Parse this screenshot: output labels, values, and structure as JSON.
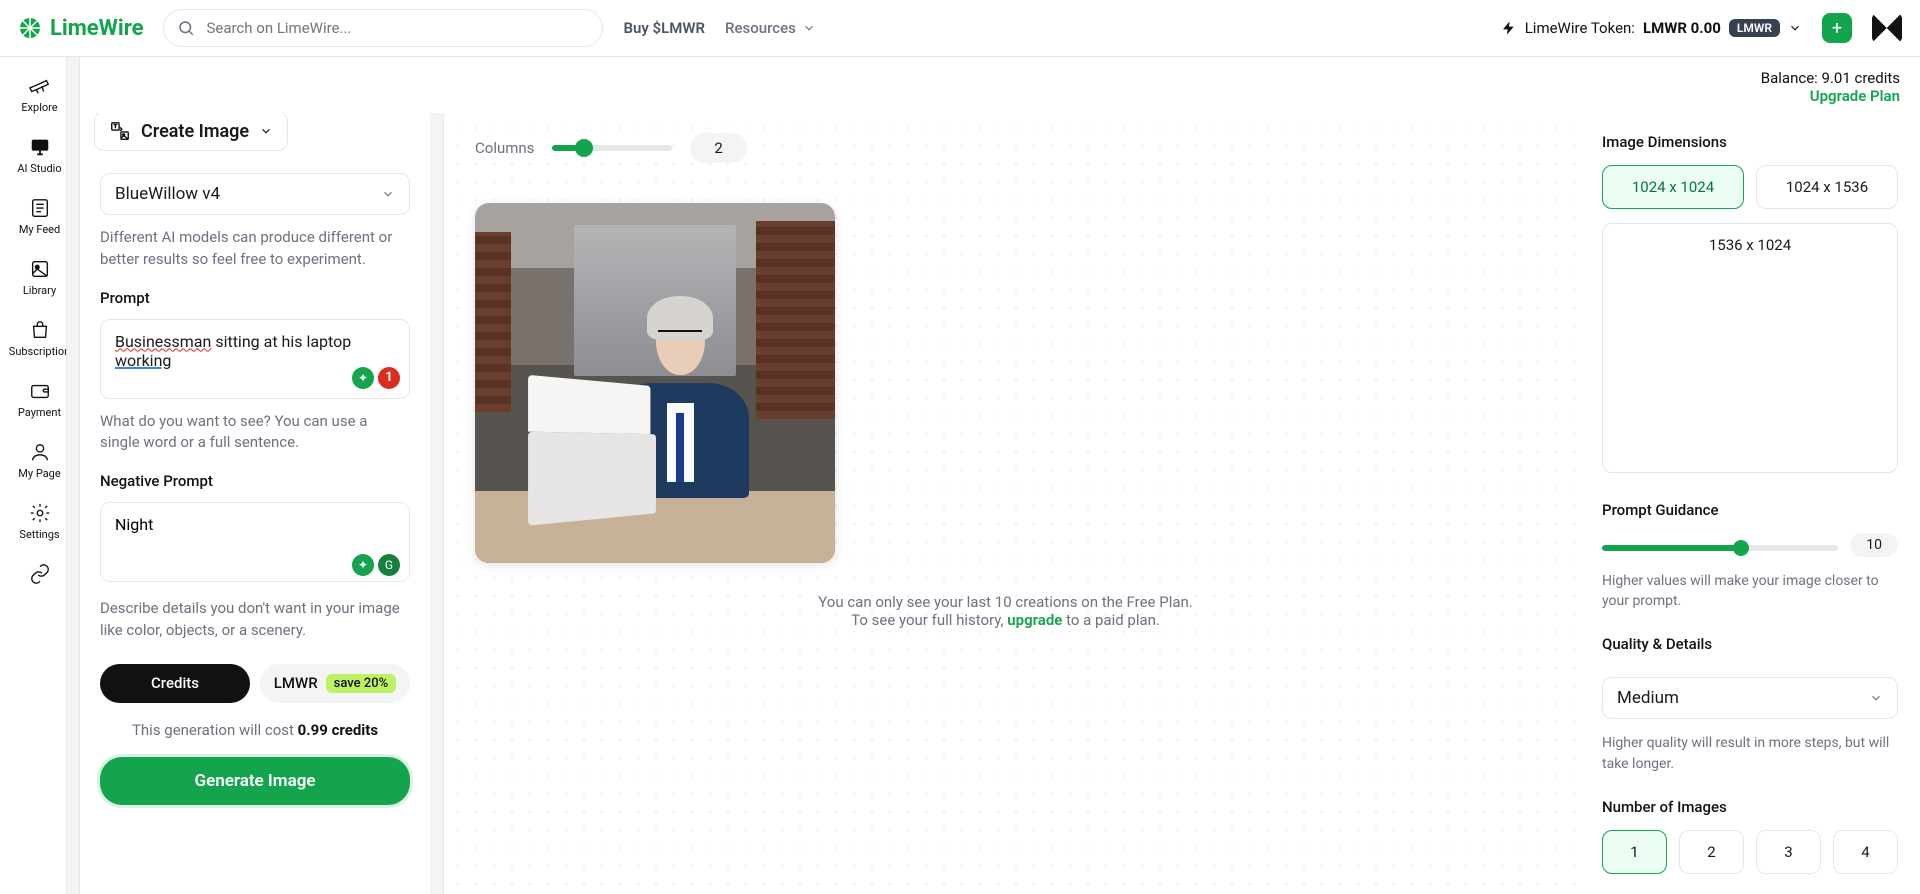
{
  "brand": "LimeWire",
  "search_placeholder": "Search on LimeWire...",
  "header": {
    "buy": "Buy $LMWR",
    "resources": "Resources",
    "token_label": "LimeWire Token:",
    "token_value": "LMWR 0.00",
    "token_badge": "LMWR"
  },
  "nav": {
    "explore": "Explore",
    "ai_studio": "AI Studio",
    "my_feed": "My Feed",
    "library": "Library",
    "subscription": "Subscription",
    "payment": "Payment",
    "my_page": "My Page",
    "settings": "Settings"
  },
  "balance": {
    "text": "Balance: 9.01 credits",
    "upgrade": "Upgrade Plan"
  },
  "panel": {
    "create": "Create Image",
    "model": "BlueWillow v4",
    "model_help": "Different AI models can produce different or better results so feel free to experiment.",
    "prompt_label": "Prompt",
    "prompt_value": "Businessman sitting at his laptop working",
    "prompt_badge": "1",
    "prompt_help": "What do you want to see? You can use a single word or a full sentence.",
    "neg_label": "Negative Prompt",
    "neg_value": "Night",
    "neg_help": "Describe details you don't want in your image like color, objects, or a scenery.",
    "credits": "Credits",
    "lmwr": "LMWR",
    "save20": "save 20%",
    "cost_pre": "This generation will cost ",
    "cost_val": "0.99 credits",
    "generate": "Generate Image"
  },
  "center": {
    "columns": "Columns",
    "columns_count": "2",
    "free1": "You can only see your last 10 creations on the Free Plan.",
    "free2a": "To see your full history, ",
    "free2b": "upgrade",
    "free2c": " to a paid plan."
  },
  "right": {
    "dim_title": "Image Dimensions",
    "dims": [
      "1024 x 1024",
      "1024 x 1536",
      "1536 x 1024"
    ],
    "pg_title": "Prompt Guidance",
    "pg_value": "10",
    "pg_help": "Higher values will make your image closer to your prompt.",
    "q_title": "Quality & Details",
    "q_value": "Medium",
    "q_help": "Higher quality will result in more steps, but will take longer.",
    "n_title": "Number of Images",
    "nums": [
      "1",
      "2",
      "3",
      "4"
    ]
  }
}
